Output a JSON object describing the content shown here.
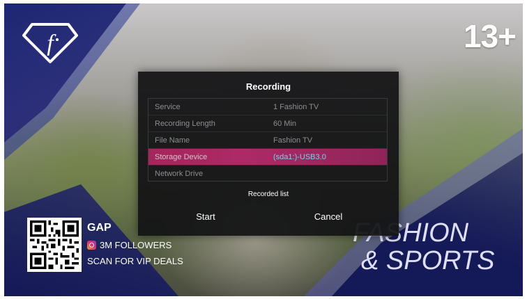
{
  "overlay": {
    "age_rating": "13+",
    "logo_icon": "fashion-tv-diamond-logo"
  },
  "dialog": {
    "title": "Recording",
    "rows": [
      {
        "label": "Service",
        "value": "1 Fashion TV"
      },
      {
        "label": "Recording Length",
        "value": "60 Min"
      },
      {
        "label": "File Name",
        "value": "Fashion TV"
      },
      {
        "label": "Storage Device",
        "value": "(sda1:)-USB3.0",
        "selected": true
      },
      {
        "label": "Network Drive",
        "value": ""
      }
    ],
    "recorded_list_label": "Recorded list",
    "start_label": "Start",
    "cancel_label": "Cancel",
    "highlight_color": "#a3265c",
    "selected_value_color": "#6fd6f0"
  },
  "promo": {
    "brand": "GAP",
    "followers": "3M FOLLOWERS",
    "scan_text": "SCAN FOR VIP DEALS",
    "social_icon": "instagram-icon"
  },
  "tagline": {
    "line1": "FASHION",
    "line2": "& SPORTS"
  }
}
